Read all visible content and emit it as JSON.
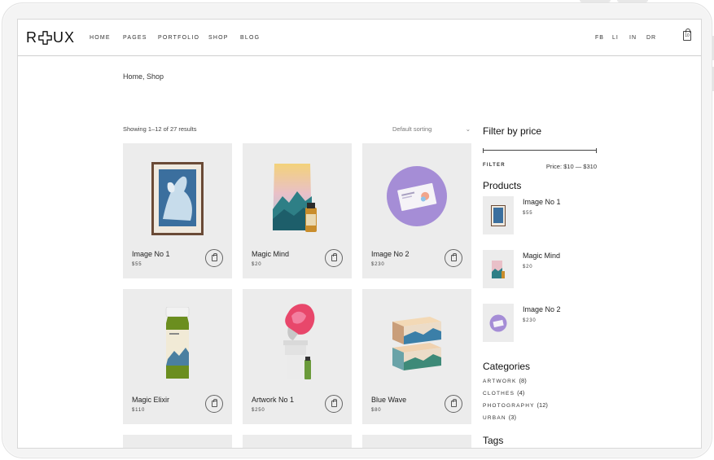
{
  "header": {
    "logo": {
      "left": "R",
      "right": "UX"
    },
    "nav": [
      "HOME",
      "PAGES",
      "PORTFOLIO",
      "SHOP",
      "BLOG"
    ],
    "social": [
      "FB",
      "LI",
      "IN",
      "DR"
    ],
    "cart_count": "10"
  },
  "breadcrumb": "Home,  Shop",
  "toolbar": {
    "results": "Showing 1–12 of 27 results",
    "sorting": "Default sorting",
    "sorting_chevron": "⌄"
  },
  "products": [
    {
      "title": "Image No 1",
      "price": "$55"
    },
    {
      "title": "Magic Mind",
      "price": "$20"
    },
    {
      "title": "Image No 2",
      "price": "$230"
    },
    {
      "title": "Magic Elixir",
      "price": "$110"
    },
    {
      "title": "Artwork No 1",
      "price": "$250"
    },
    {
      "title": "Blue Wave",
      "price": "$80"
    }
  ],
  "sidebar": {
    "filter_title": "Filter by price",
    "filter_button": "FILTER",
    "price_range": "Price: $10 — $310",
    "products_title": "Products",
    "products": [
      {
        "name": "Image No 1",
        "price": "$55"
      },
      {
        "name": "Magic Mind",
        "price": "$20"
      },
      {
        "name": "Image No 2",
        "price": "$230"
      }
    ],
    "categories_title": "Categories",
    "categories": [
      {
        "name": "ARTWORK",
        "count": "(8)"
      },
      {
        "name": "CLOTHES",
        "count": "(4)"
      },
      {
        "name": "PHOTOGRAPHY",
        "count": "(12)"
      },
      {
        "name": "URBAN",
        "count": "(3)"
      }
    ],
    "tags_title": "Tags"
  },
  "icons": {
    "cart": "shopping-bag-icon",
    "add_to_cart": "bag-icon",
    "logo_mark": "plus-cross-icon"
  }
}
